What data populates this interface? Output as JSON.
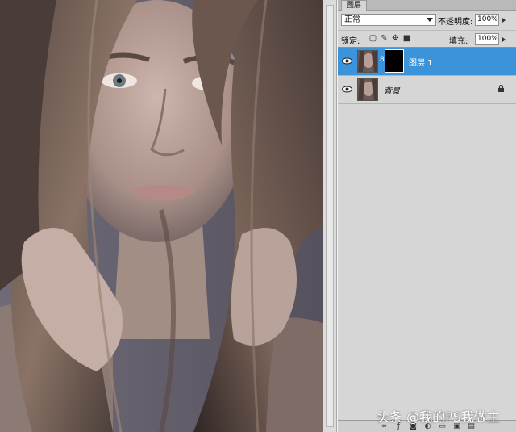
{
  "panel": {
    "tab_label": "图层",
    "blend_mode": "正常",
    "opacity_label": "不透明度:",
    "opacity_value": "100%",
    "lock_label": "锁定:",
    "fill_label": "填充:",
    "fill_value": "100%"
  },
  "layers": [
    {
      "name": "图层 1",
      "selected": true,
      "visible": true,
      "has_mask": true
    },
    {
      "name": "背景",
      "selected": false,
      "visible": true,
      "locked": true
    }
  ],
  "watermark": "头条 @我的PS我做主",
  "colors": {
    "selection": "#3b94d9",
    "panel_bg": "#d6d6d6",
    "canvas_bg": "#6e6c78"
  }
}
